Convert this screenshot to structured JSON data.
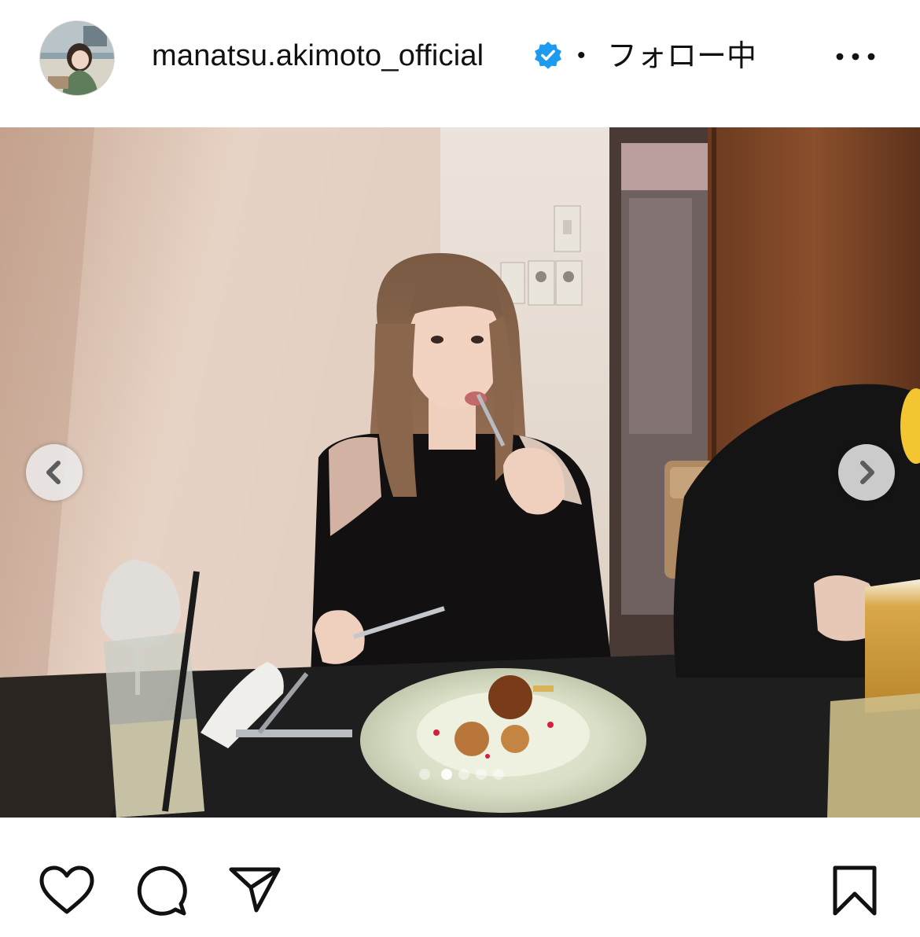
{
  "header": {
    "username": "manatsu.akimoto_official",
    "separator": "•",
    "follow_status": "フォロー中",
    "icons": {
      "avatar": "profile-avatar",
      "verified": "verified-badge-icon",
      "more": "more-options-icon"
    },
    "verified_color": "#1d9bf0"
  },
  "post": {
    "media_type": "photo-carousel",
    "carousel": {
      "slide_count": 5,
      "active_slide": 2
    },
    "nav_icons": [
      "chevron-left-icon",
      "chevron-right-icon"
    ]
  },
  "actions": {
    "icons": [
      "heart-icon",
      "comment-icon",
      "share-icon",
      "bookmark-icon"
    ]
  }
}
